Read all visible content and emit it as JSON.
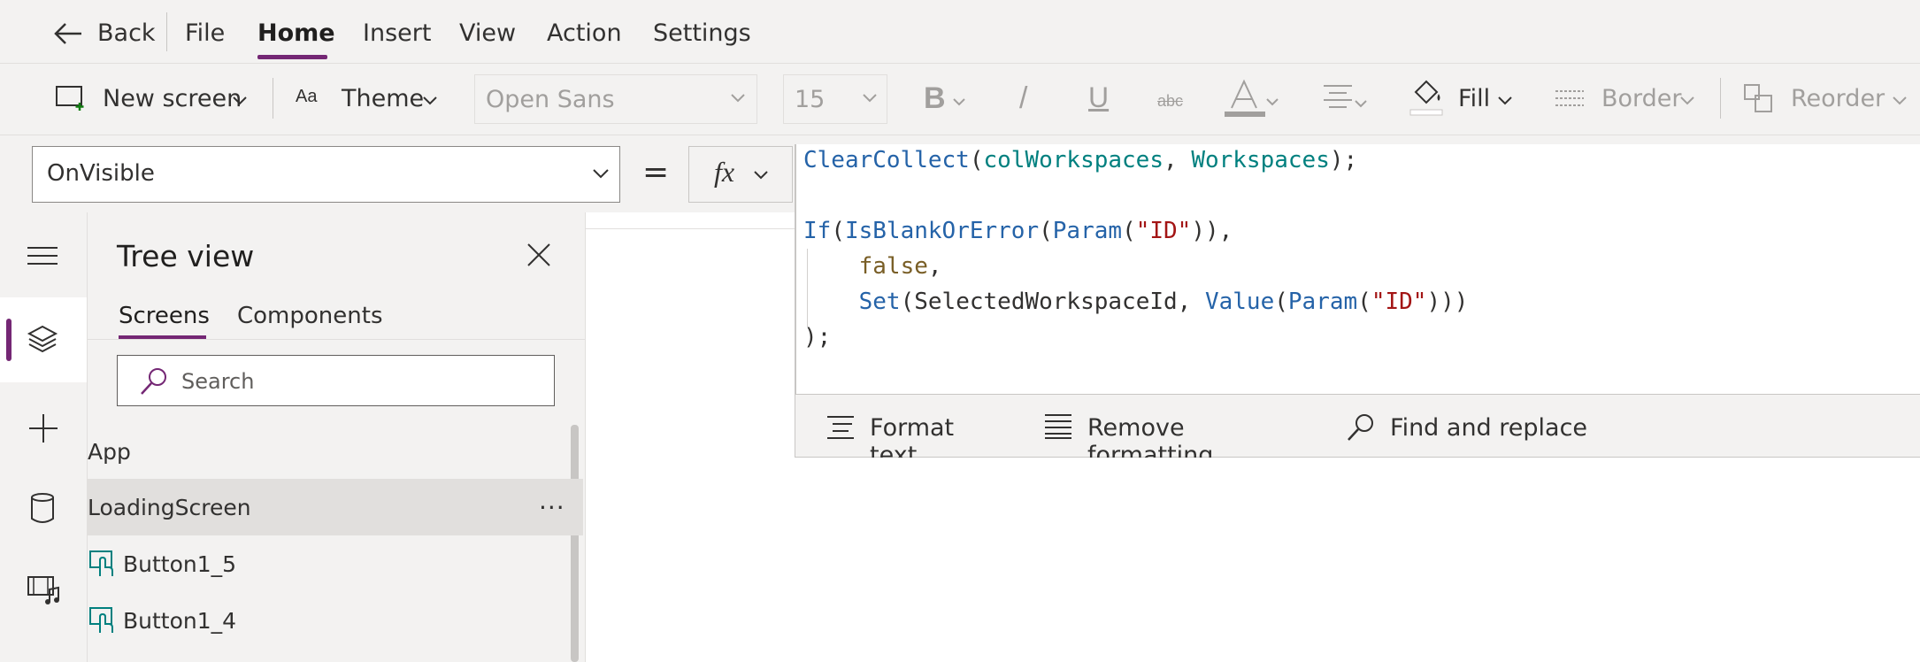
{
  "menubar": {
    "back_label": "Back",
    "items": [
      {
        "label": "File"
      },
      {
        "label": "Home",
        "active": true
      },
      {
        "label": "Insert"
      },
      {
        "label": "View"
      },
      {
        "label": "Action"
      },
      {
        "label": "Settings"
      }
    ]
  },
  "ribbon": {
    "new_screen_label": "New screen",
    "theme_label": "Theme",
    "font_family": "Open Sans",
    "font_size": "15",
    "bold_label": "B",
    "italic_label": "/",
    "underline_label": "U",
    "strike_label": "abc",
    "fill_label": "Fill",
    "border_label": "Border",
    "reorder_label": "Reorder"
  },
  "formula": {
    "property": "OnVisible",
    "equals": "=",
    "fx_label": "fx",
    "code_lines": [
      [
        {
          "t": "ClearCollect",
          "c": "#2563a8"
        },
        {
          "t": "(",
          "c": "#323130"
        },
        {
          "t": "colWorkspaces",
          "c": "#00807f"
        },
        {
          "t": ", ",
          "c": "#323130"
        },
        {
          "t": "Workspaces",
          "c": "#00807f"
        },
        {
          "t": ");",
          "c": "#323130"
        }
      ],
      [],
      [
        {
          "t": "If",
          "c": "#2563a8"
        },
        {
          "t": "(",
          "c": "#323130"
        },
        {
          "t": "IsBlankOrError",
          "c": "#2563a8"
        },
        {
          "t": "(",
          "c": "#323130"
        },
        {
          "t": "Param",
          "c": "#2563a8"
        },
        {
          "t": "(",
          "c": "#323130"
        },
        {
          "t": "\"ID\"",
          "c": "#a31515"
        },
        {
          "t": ")),",
          "c": "#323130"
        }
      ],
      [
        {
          "t": "    ",
          "c": "#323130"
        },
        {
          "t": "false",
          "c": "#795e26"
        },
        {
          "t": ",",
          "c": "#323130"
        }
      ],
      [
        {
          "t": "    ",
          "c": "#323130"
        },
        {
          "t": "Set",
          "c": "#2563a8"
        },
        {
          "t": "(SelectedWorkspaceId, ",
          "c": "#323130"
        },
        {
          "t": "Value",
          "c": "#2563a8"
        },
        {
          "t": "(",
          "c": "#323130"
        },
        {
          "t": "Param",
          "c": "#2563a8"
        },
        {
          "t": "(",
          "c": "#323130"
        },
        {
          "t": "\"ID\"",
          "c": "#a31515"
        },
        {
          "t": ")))",
          "c": "#323130"
        }
      ],
      [
        {
          "t": ");",
          "c": "#323130"
        }
      ]
    ],
    "format_text_label": "Format text",
    "remove_formatting_label": "Remove formatting",
    "find_replace_label": "Find and replace"
  },
  "tree": {
    "title": "Tree view",
    "tabs": [
      {
        "label": "Screens",
        "active": true
      },
      {
        "label": "Components"
      }
    ],
    "search_placeholder": "Search",
    "items": [
      {
        "label": "App",
        "selected": false
      },
      {
        "label": "LoadingScreen",
        "selected": true,
        "more": "..."
      },
      {
        "label": "Button1_5",
        "icon": "button-icon"
      },
      {
        "label": "Button1_4",
        "icon": "button-icon"
      }
    ]
  },
  "colors": {
    "accent": "#742774",
    "selected_row": "#e1dfdd"
  }
}
